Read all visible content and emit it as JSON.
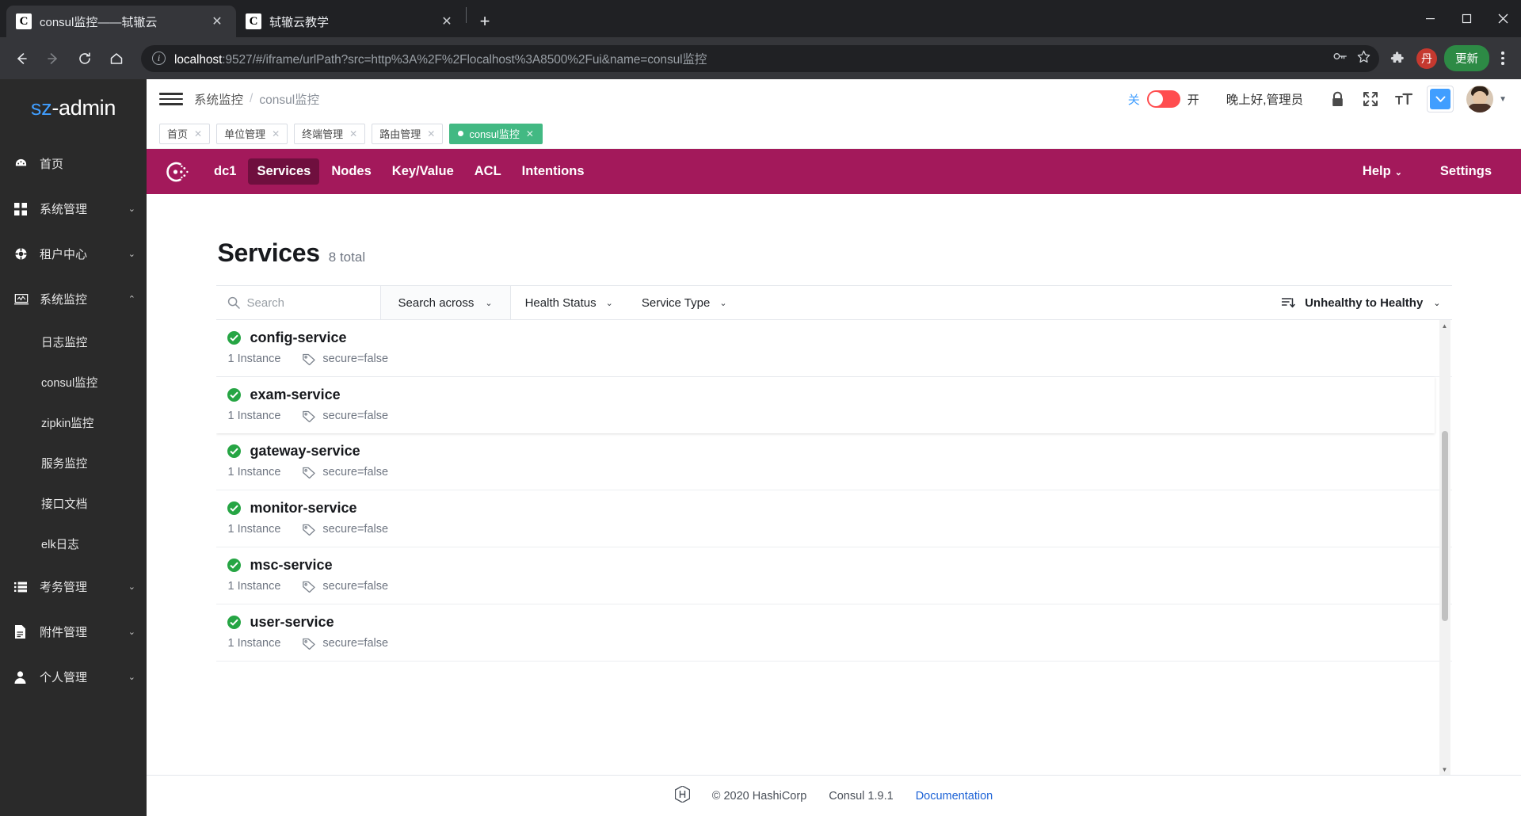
{
  "browser": {
    "tabs": [
      {
        "favicon": "C",
        "title": "consul监控——轼辙云",
        "active": true
      },
      {
        "favicon": "C",
        "title": "轼辙云教学",
        "active": false
      }
    ],
    "new_tab_label": "+",
    "close_label": "✕",
    "url_host": "localhost",
    "url_rest": ":9527/#/iframe/urlPath?src=http%3A%2F%2Flocalhost%3A8500%2Fui&name=consul监控",
    "update_button": "更新",
    "profile_initial": "丹"
  },
  "sidebar": {
    "logo_prefix": "sz",
    "logo_suffix": "-admin",
    "items": [
      {
        "icon": "dashboard-icon",
        "label": "首页",
        "expandable": false
      },
      {
        "icon": "grid-icon",
        "label": "系统管理",
        "expandable": true,
        "arrow": "⌄"
      },
      {
        "icon": "tenant-icon",
        "label": "租户中心",
        "expandable": true,
        "arrow": "⌄"
      },
      {
        "icon": "monitor-icon",
        "label": "系统监控",
        "expandable": true,
        "arrow": "⌃"
      }
    ],
    "sub_items": [
      {
        "label": "日志监控"
      },
      {
        "label": "consul监控"
      },
      {
        "label": "zipkin监控"
      },
      {
        "label": "服务监控"
      },
      {
        "label": "接口文档"
      },
      {
        "label": "elk日志"
      }
    ],
    "items_bottom": [
      {
        "icon": "list-icon",
        "label": "考务管理",
        "expandable": true,
        "arrow": "⌄"
      },
      {
        "icon": "file-icon",
        "label": "附件管理",
        "expandable": true,
        "arrow": "⌄"
      },
      {
        "icon": "user-icon",
        "label": "个人管理",
        "expandable": true,
        "arrow": "⌄"
      }
    ]
  },
  "topbar": {
    "breadcrumb_parent": "系统监控",
    "breadcrumb_sep": "/",
    "breadcrumb_current": "consul监控",
    "switch_off_label": "关",
    "switch_on_label": "开",
    "greeting": "晚上好,管理员",
    "icons": [
      "lock-icon",
      "fullscreen-icon",
      "text-size-icon",
      "chevron-down-icon",
      "avatar"
    ]
  },
  "page_tabs": [
    {
      "label": "首页",
      "active": false
    },
    {
      "label": "单位管理",
      "active": false
    },
    {
      "label": "终端管理",
      "active": false
    },
    {
      "label": "路由管理",
      "active": false
    },
    {
      "label": "consul监控",
      "active": true
    }
  ],
  "consul": {
    "nav": {
      "datacenter": "dc1",
      "items": [
        {
          "label": "Services",
          "active": true
        },
        {
          "label": "Nodes",
          "active": false
        },
        {
          "label": "Key/Value",
          "active": false
        },
        {
          "label": "ACL",
          "active": false
        },
        {
          "label": "Intentions",
          "active": false
        }
      ],
      "help": "Help",
      "settings": "Settings",
      "chevron": "⌄"
    },
    "page": {
      "title": "Services",
      "total": "8 total"
    },
    "filters": {
      "search_placeholder": "Search",
      "search_across": "Search across",
      "health_status": "Health Status",
      "service_type": "Service Type",
      "sort": "Unhealthy to Healthy",
      "chevron": "⌄"
    },
    "services": [
      {
        "name": "config-service",
        "status": "passing",
        "instances": "1 Instance",
        "tag": "secure=false",
        "raised": false
      },
      {
        "name": "exam-service",
        "status": "passing",
        "instances": "1 Instance",
        "tag": "secure=false",
        "raised": true
      },
      {
        "name": "gateway-service",
        "status": "passing",
        "instances": "1 Instance",
        "tag": "secure=false",
        "raised": false
      },
      {
        "name": "monitor-service",
        "status": "passing",
        "instances": "1 Instance",
        "tag": "secure=false",
        "raised": false
      },
      {
        "name": "msc-service",
        "status": "passing",
        "instances": "1 Instance",
        "tag": "secure=false",
        "raised": false
      },
      {
        "name": "user-service",
        "status": "passing",
        "instances": "1 Instance",
        "tag": "secure=false",
        "raised": false
      }
    ],
    "footer": {
      "copyright": "© 2020 HashiCorp",
      "version": "Consul 1.9.1",
      "documentation": "Documentation"
    }
  },
  "colors": {
    "consul_magenta": "#a3195b",
    "consul_active_tab": "#6f0f3e",
    "sidebar_bg": "#2a2a2a",
    "accent_blue": "#409eff",
    "tab_green": "#42b983",
    "status_green": "#26a544",
    "switch_red": "#ff4d4f"
  }
}
